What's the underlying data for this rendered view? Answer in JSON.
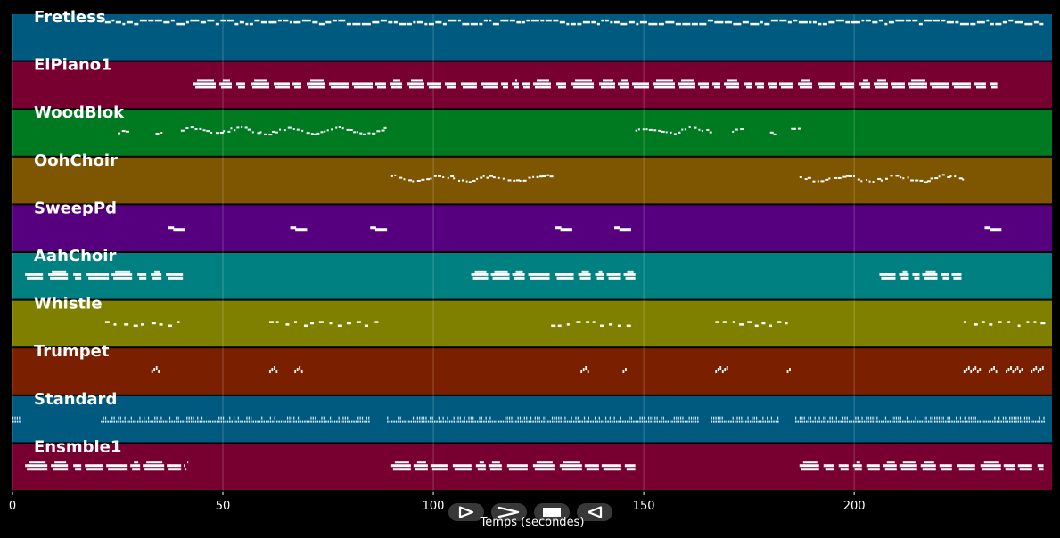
{
  "colors": {
    "background": "#000000",
    "note": "#ffffff",
    "grid": "#ffffff"
  },
  "xaxis": {
    "label": "Temps (secondes)",
    "min": 0,
    "max": 247,
    "ticks": [
      0,
      50,
      100,
      150,
      200
    ]
  },
  "controls": [
    {
      "name": "play-button",
      "icon": "play-icon"
    },
    {
      "name": "fast-forward-button",
      "icon": "fast-forward-icon"
    },
    {
      "name": "stop-button",
      "icon": "stop-icon"
    },
    {
      "name": "rewind-button",
      "icon": "rewind-icon"
    }
  ],
  "tracks": [
    {
      "name": "Fretless",
      "color": "#005a80",
      "style": "bass",
      "segments": [
        [
          22,
          245
        ]
      ]
    },
    {
      "name": "ElPiano1",
      "color": "#780030",
      "style": "chords",
      "segments": [
        [
          43,
          234
        ]
      ]
    },
    {
      "name": "WoodBlok",
      "color": "#007a20",
      "style": "sparse",
      "segments": [
        [
          25,
          27
        ],
        [
          34,
          36
        ],
        [
          40,
          89
        ],
        [
          148,
          166
        ],
        [
          171,
          173
        ],
        [
          180,
          182
        ],
        [
          185,
          187
        ]
      ]
    },
    {
      "name": "OohChoir",
      "color": "#7e5500",
      "style": "sparse",
      "segments": [
        [
          90,
          128
        ],
        [
          187,
          226
        ]
      ]
    },
    {
      "name": "SweepPd",
      "color": "#560080",
      "style": "blocks",
      "segments": [
        [
          37,
          41
        ],
        [
          66,
          70
        ],
        [
          85,
          89
        ],
        [
          129,
          133
        ],
        [
          143,
          147
        ],
        [
          231,
          235
        ]
      ]
    },
    {
      "name": "AahChoir",
      "color": "#008080",
      "style": "chords",
      "segments": [
        [
          3,
          41
        ],
        [
          109,
          148
        ],
        [
          206,
          226
        ]
      ]
    },
    {
      "name": "Whistle",
      "color": "#808000",
      "style": "phrase",
      "segments": [
        [
          22,
          40
        ],
        [
          61,
          88
        ],
        [
          128,
          147
        ],
        [
          167,
          185
        ],
        [
          226,
          245
        ]
      ]
    },
    {
      "name": "Trumpet",
      "color": "#7a2000",
      "style": "hits",
      "segments": [
        [
          33,
          35
        ],
        [
          61,
          63
        ],
        [
          67,
          69
        ],
        [
          135,
          137
        ],
        [
          145,
          146
        ],
        [
          167,
          170
        ],
        [
          184,
          185
        ],
        [
          226,
          230
        ],
        [
          232,
          234
        ],
        [
          236,
          240
        ],
        [
          242,
          245
        ]
      ]
    },
    {
      "name": "Standard",
      "color": "#005a80",
      "style": "drums",
      "segments": [
        [
          0,
          2
        ],
        [
          21,
          85
        ],
        [
          89,
          163
        ],
        [
          166,
          182
        ],
        [
          186,
          245
        ]
      ]
    },
    {
      "name": "Ensmble1",
      "color": "#780030",
      "style": "chords",
      "segments": [
        [
          3,
          41
        ],
        [
          90,
          148
        ],
        [
          187,
          245
        ]
      ]
    }
  ]
}
